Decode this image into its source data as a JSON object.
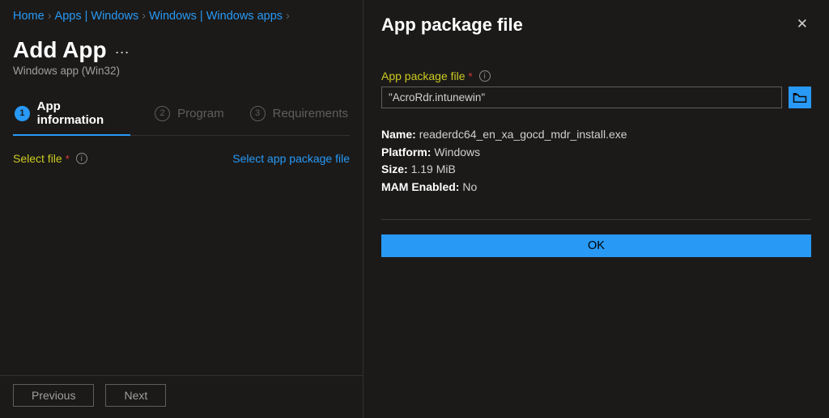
{
  "breadcrumb": {
    "items": [
      {
        "label": "Home"
      },
      {
        "label": "Apps | Windows"
      },
      {
        "label": "Windows | Windows apps"
      }
    ]
  },
  "page": {
    "title": "Add App",
    "subtitle": "Windows app (Win32)"
  },
  "tabs": [
    {
      "num": "1",
      "label": "App information"
    },
    {
      "num": "2",
      "label": "Program"
    },
    {
      "num": "3",
      "label": "Requirements"
    }
  ],
  "select_file": {
    "label": "Select file",
    "link": "Select app package file"
  },
  "footer": {
    "previous": "Previous",
    "next": "Next"
  },
  "panel": {
    "title": "App package file",
    "field_label": "App package file",
    "file_value": "\"AcroRdr.intunewin\"",
    "meta": {
      "name_label": "Name:",
      "name_value": "readerdc64_en_xa_gocd_mdr_install.exe",
      "platform_label": "Platform:",
      "platform_value": "Windows",
      "size_label": "Size:",
      "size_value": "1.19 MiB",
      "mam_label": "MAM Enabled:",
      "mam_value": "No"
    },
    "ok": "OK"
  }
}
